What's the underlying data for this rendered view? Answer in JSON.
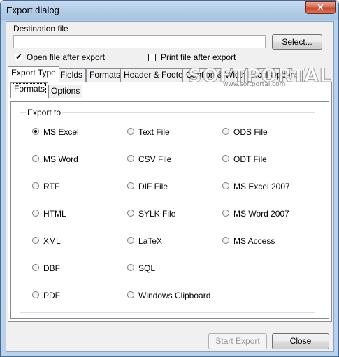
{
  "window": {
    "title": "Export dialog",
    "close_glyph": "X"
  },
  "destination": {
    "label": "Destination file",
    "value": "",
    "select_button": "Select...",
    "open_after_label": "Open file after export",
    "open_after_checked": true,
    "print_after_label": "Print file after export",
    "print_after_checked": false
  },
  "tabs": [
    {
      "label": "Export Type",
      "active": true
    },
    {
      "label": "Fields"
    },
    {
      "label": "Formats"
    },
    {
      "label": "Header & Footer"
    },
    {
      "label": "Caption & Width"
    },
    {
      "label": "Excel Options"
    }
  ],
  "subtabs": [
    {
      "label": "Formats",
      "active": true
    },
    {
      "label": "Options"
    }
  ],
  "export_to": {
    "title": "Export to",
    "selected": "MS Excel",
    "columns": [
      [
        "MS Excel",
        "MS Word",
        "RTF",
        "HTML",
        "XML",
        "DBF",
        "PDF"
      ],
      [
        "Text File",
        "CSV File",
        "DIF File",
        "SYLK File",
        "LaTeX",
        "SQL",
        "Windows Clipboard"
      ],
      [
        "ODS File",
        "ODT File",
        "MS Excel 2007",
        "MS Word 2007",
        "MS Access"
      ]
    ]
  },
  "watermark": {
    "main": "SOFTPORTAL",
    "sub": "www.softportal.com"
  },
  "footer": {
    "start_button": "Start Export",
    "close_button": "Close"
  },
  "colors": {
    "title_bar": "#b9d1ea",
    "close_button": "#c3452a",
    "dialog_bg": "#f0f0f0"
  }
}
